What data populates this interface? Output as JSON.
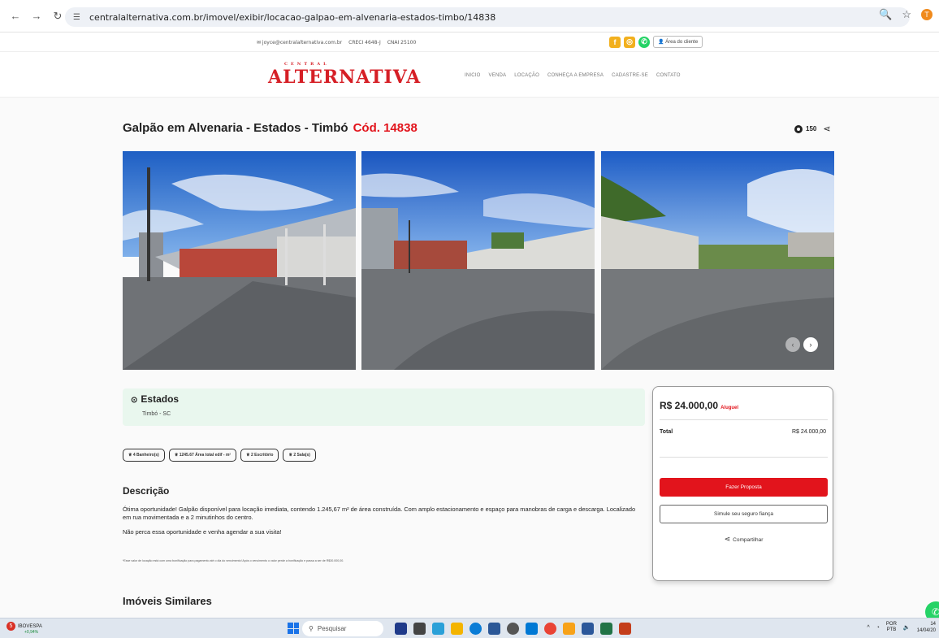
{
  "browser": {
    "url": "centralalternativa.com.br/imovel/exibir/locacao-galpao-em-alvenaria-estados-timbo/14838",
    "profile_initial": "T"
  },
  "topbar": {
    "email": "✉ joyce@centralalternativa.com.br",
    "creci": "CRECI 4648-J",
    "cnai": "CNAI 25100",
    "area_cliente": "Área do cliente"
  },
  "header": {
    "logo_top": "CENTRAL",
    "logo_main": "ALTERNATIVA",
    "menu": [
      "INICIO",
      "VENDA",
      "LOCAÇÃO",
      "CONHEÇA A EMPRESA",
      "CADASTRE-SE",
      "CONTATO"
    ]
  },
  "listing": {
    "title": "Galpão em Alvenaria - Estados - Timbó",
    "code": "Cód. 14838",
    "views": "150",
    "neighborhood": "Estados",
    "city": "Timbó - SC",
    "features": [
      "4 Banheiro(s)",
      "1245.67 Área total edif - m²",
      "2 Escritório",
      "2 Sala(s)"
    ],
    "description_title": "Descrição",
    "description_p1": "Ótima oportunidade! Galpão disponível para locação imediata, contendo 1.245,67 m² de área construída. Com amplo estacionamento e espaço para manobras de carga e descarga. Localizado em rua movimentada e a 2 minutinhos do centro.",
    "description_p2": "Não perca essa oportunidade e venha agendar a sua visita!",
    "disclaimer": "*Esse valor de locação está com uma bonificação para pagamento até o dia do vencimento! Após o vencimento o valor perde a bonificação e passa a ser de R$30.000,00.",
    "similar_title": "Imóveis Similares"
  },
  "price_card": {
    "price": "R$ 24.000,00",
    "price_type": "Aluguel",
    "total_label": "Total",
    "total_value": "R$ 24.000,00",
    "proposal_button": "Fazer Proposta",
    "insurance_button": "Simule seu seguro fiança",
    "share_label": "Compartilhar"
  },
  "taskbar": {
    "stock_name": "IBOVESPA",
    "stock_change": "+0,94%",
    "stock_badge": "5",
    "search_placeholder": "Pesquisar",
    "lang": "POR",
    "lang2": "PTB",
    "time": "14",
    "date": "14/04/20"
  },
  "colors": {
    "brand_red": "#e2141c",
    "location_bg": "#e9f7ee",
    "whatsapp": "#25d366"
  }
}
